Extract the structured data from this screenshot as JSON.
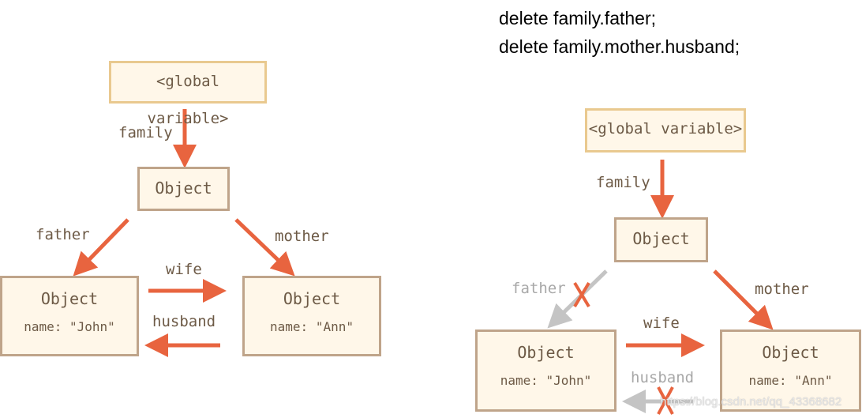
{
  "code_lines": [
    "delete family.father;",
    "delete family.mother.husband;"
  ],
  "left": {
    "global": "<global variable>",
    "family": "family",
    "root_object": "Object",
    "father": "father",
    "mother": "mother",
    "wife": "wife",
    "husband": "husband",
    "john": {
      "title": "Object",
      "name": "name: \"John\""
    },
    "ann": {
      "title": "Object",
      "name": "name: \"Ann\""
    }
  },
  "right": {
    "global": "<global variable>",
    "family": "family",
    "root_object": "Object",
    "father": "father",
    "mother": "mother",
    "wife": "wife",
    "husband": "husband",
    "john": {
      "title": "Object",
      "name": "name: \"John\""
    },
    "ann": {
      "title": "Object",
      "name": "name: \"Ann\""
    },
    "deleted_refs": [
      "father",
      "husband"
    ]
  },
  "watermark": "https://blog.csdn.net/qq_43368682",
  "colors": {
    "arrow": "#e8643f",
    "deleted_arrow": "#c4c4c4",
    "box_fill": "#fff7e9",
    "box_border": "#bfa48a",
    "global_border": "#e9c98f",
    "text": "#6d5a46"
  }
}
